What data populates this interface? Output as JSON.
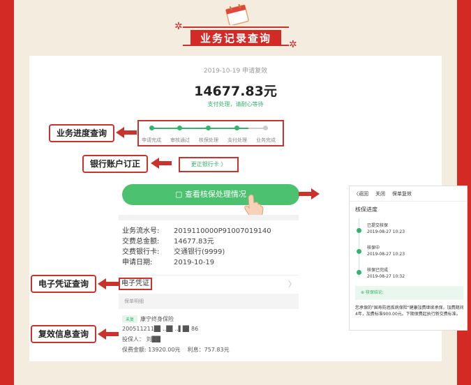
{
  "header": {
    "title": "业务记录查询"
  },
  "record": {
    "date_status": "2019-10-19 申请复效",
    "amount": "14677.83元",
    "pay_hint": "支付处理，请耐心等待"
  },
  "progress": {
    "steps": [
      "申请完成",
      "审核通过",
      "核保处理",
      "支付处理",
      "业务完成"
    ]
  },
  "bank_link": "更正银行卡 〉",
  "check_button": "查看核保处理情况",
  "details": [
    {
      "label": "业务流水号:",
      "value": "2019110000P91007019140"
    },
    {
      "label": "交费总金额:",
      "value": "14677.83元"
    },
    {
      "label": "交费银行卡:",
      "value": "交通银行(9999)"
    },
    {
      "label": "申请日期:",
      "value": "2019-10-19"
    }
  ],
  "voucher_label": "电子凭证",
  "policy": {
    "header": "保单明细",
    "tag": "未复",
    "product": "康宁终身保险",
    "policy_no": "200511211█▌..█▌..▌█▌86",
    "insured": "投保人： 刘██",
    "premium": "保费金额: 13920.00元",
    "interest": "利息：757.83元"
  },
  "phone": {
    "back": "〈返回",
    "close": "关闭",
    "title": "保单复效",
    "section": "核保进度",
    "steps": [
      {
        "name": "已提交核保",
        "time": "2019-08-27 10:23"
      },
      {
        "name": "核保中",
        "time": "2019-08-27 10:23"
      },
      {
        "name": "核保已完成",
        "time": "2019-08-27 10:32"
      }
    ],
    "result_label": "⊕ 核保结论:",
    "note": "您承保的\"国寿防癌疾病保险\"健康加费继续承保，加费期间4年，加费标准900.00元。下期保费起执行新交费标准。"
  },
  "callouts": {
    "progress": "业务进度查询",
    "bank": "银行账户订正",
    "voucher": "电子凭证查询",
    "reinstate": "复效信息查询"
  },
  "colors": {
    "brand_red": "#d42a26",
    "green": "#33b36b",
    "button_green": "#4cc271"
  }
}
